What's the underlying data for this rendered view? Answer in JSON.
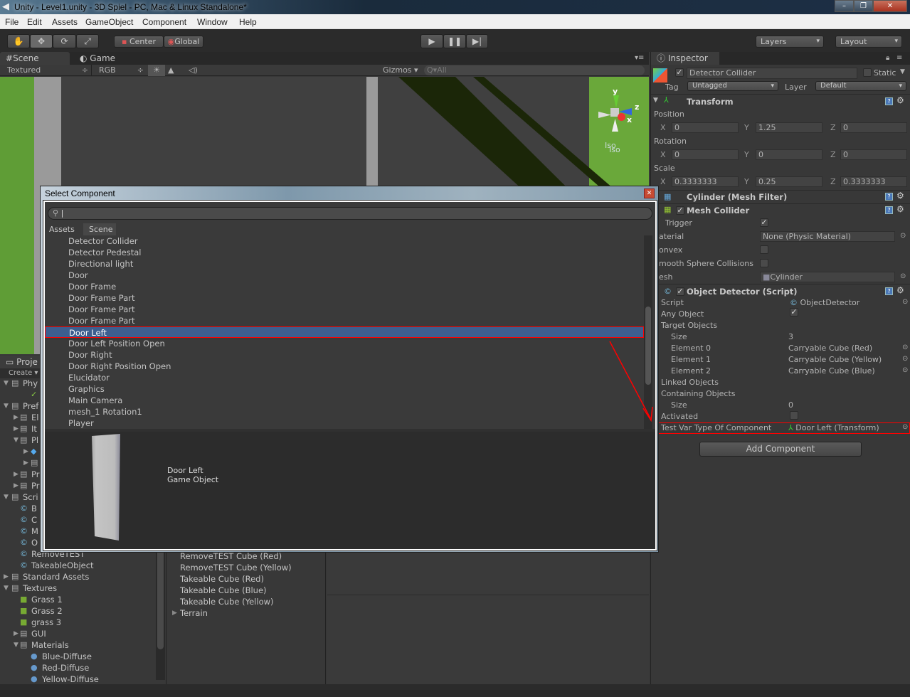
{
  "window": {
    "title": "Unity - Level1.unity - 3D Spiel - PC, Mac & Linux Standalone*",
    "controls": [
      "minimize",
      "maximize",
      "close"
    ]
  },
  "menu": [
    "File",
    "Edit",
    "Assets",
    "GameObject",
    "Component",
    "Window",
    "Help"
  ],
  "toolbar": {
    "tools": [
      "hand-icon",
      "move-icon",
      "rotate-icon",
      "scale-icon"
    ],
    "pivot": "Center",
    "space": "Global",
    "play": [
      "play-icon",
      "pause-icon",
      "step-icon"
    ],
    "layers": "Layers",
    "layout": "Layout"
  },
  "scene": {
    "tabs": [
      "Scene",
      "Game"
    ],
    "render_mode": "Textured",
    "channel": "RGB",
    "gizmos": "Gizmos",
    "search_placeholder": "All",
    "axis": {
      "x": "x",
      "y": "y",
      "z": "z"
    },
    "projection": "Iso"
  },
  "project": {
    "tab": "Proje",
    "create": "Create",
    "items": [
      {
        "label": "Phy",
        "level": 0,
        "icon": "folder",
        "open": true
      },
      {
        "label": "S",
        "level": 2,
        "icon": "physics-material"
      },
      {
        "label": "Pref",
        "level": 0,
        "icon": "folder",
        "open": true
      },
      {
        "label": "El",
        "level": 1,
        "icon": "folder",
        "open": false
      },
      {
        "label": "It",
        "level": 1,
        "icon": "folder",
        "open": false
      },
      {
        "label": "Pl",
        "level": 1,
        "icon": "folder",
        "open": true
      },
      {
        "label": "",
        "level": 2,
        "icon": "prefab",
        "open": false
      },
      {
        "label": "",
        "level": 2,
        "icon": "folder",
        "open": false
      },
      {
        "label": "Pr",
        "level": 1,
        "icon": "folder",
        "open": false
      },
      {
        "label": "Pr",
        "level": 1,
        "icon": "folder",
        "open": false
      },
      {
        "label": "Scri",
        "level": 0,
        "icon": "folder",
        "open": true
      },
      {
        "label": "B",
        "level": 1,
        "icon": "script"
      },
      {
        "label": "C",
        "level": 1,
        "icon": "script"
      },
      {
        "label": "M",
        "level": 1,
        "icon": "script"
      },
      {
        "label": "O",
        "level": 1,
        "icon": "script"
      },
      {
        "label": "RemoveTEST",
        "level": 1,
        "icon": "script"
      },
      {
        "label": "TakeableObject",
        "level": 1,
        "icon": "script"
      },
      {
        "label": "Standard Assets",
        "level": 0,
        "icon": "folder",
        "open": false
      },
      {
        "label": "Textures",
        "level": 0,
        "icon": "folder",
        "open": true
      },
      {
        "label": "Grass 1",
        "level": 1,
        "icon": "texture"
      },
      {
        "label": "Grass 2",
        "level": 1,
        "icon": "texture"
      },
      {
        "label": "grass 3",
        "level": 1,
        "icon": "texture"
      },
      {
        "label": "GUI",
        "level": 1,
        "icon": "folder",
        "open": false
      },
      {
        "label": "Materials",
        "level": 1,
        "icon": "folder",
        "open": true
      },
      {
        "label": "Blue-Diffuse",
        "level": 2,
        "icon": "material"
      },
      {
        "label": "Red-Diffuse",
        "level": 2,
        "icon": "material"
      },
      {
        "label": "Yellow-Diffuse",
        "level": 2,
        "icon": "material"
      }
    ]
  },
  "hierarchy": {
    "items": [
      "RemoveTEST Cube (Red)",
      "RemoveTEST Cube (Yellow)",
      "Takeable Cube  (Red)",
      "Takeable Cube (Blue)",
      "Takeable Cube (Yellow)",
      "Terrain"
    ]
  },
  "inspector": {
    "tab": "Inspector",
    "object": {
      "name": "Detector Collider",
      "active": true,
      "static_label": "Static",
      "static": false,
      "tag_label": "Tag",
      "tag": "Untagged",
      "layer_label": "Layer",
      "layer": "Default"
    },
    "transform": {
      "title": "Transform",
      "position_label": "Position",
      "rotation_label": "Rotation",
      "scale_label": "Scale",
      "position": {
        "x": "0",
        "y": "1.25",
        "z": "0"
      },
      "rotation": {
        "x": "0",
        "y": "0",
        "z": "0"
      },
      "scale": {
        "x": "0.3333333",
        "y": "0.25",
        "z": "0.3333333"
      }
    },
    "axis_labels": {
      "x": "X",
      "y": "Y",
      "z": "Z"
    },
    "mesh_filter": {
      "title": "Cylinder (Mesh Filter)"
    },
    "mesh_collider": {
      "title": "Mesh Collider",
      "enabled": true,
      "trigger_label": "Trigger",
      "trigger": true,
      "material_label": "aterial",
      "material": "None (Physic Material)",
      "convex_label": "onvex",
      "convex": false,
      "smooth_label": "mooth Sphere Collisions",
      "smooth": false,
      "mesh_label": "esh",
      "mesh": "Cylinder"
    },
    "object_detector": {
      "title": "Object Detector (Script)",
      "enabled": true,
      "script_label": "Script",
      "script": "ObjectDetector",
      "any_object_label": "Any Object",
      "any_object": true,
      "target_objects_label": "Target Objects",
      "size_label": "Size",
      "target_size": "3",
      "elements": [
        {
          "label": "Element 0",
          "value": "Carryable Cube (Red)"
        },
        {
          "label": "Element 1",
          "value": "Carryable Cube (Yellow)"
        },
        {
          "label": "Element 2",
          "value": "Carryable Cube (Blue)"
        }
      ],
      "linked_label": "Linked Objects",
      "containing_label": "Containing Objects",
      "containing_size": "0",
      "activated_label": "Activated",
      "activated": false,
      "test_var_label": "Test Var Type Of Component",
      "test_var": "Door Left (Transform)"
    },
    "add_component": "Add Component"
  },
  "dialog": {
    "title": "Select Component",
    "search_value": "",
    "tabs": [
      "Assets",
      "Scene"
    ],
    "active_tab": "Scene",
    "items": [
      "Detector Collider",
      "Detector Pedestal",
      "Directional light",
      "Door",
      "Door Frame",
      "Door Frame Part",
      "Door Frame Part",
      "Door Frame Part",
      "Door Left",
      "Door Left Position Open",
      "Door Right",
      "Door Right Position Open",
      "Elucidator",
      "Graphics",
      "Main Camera",
      "mesh_1 Rotation1",
      "Player"
    ],
    "selected": "Door Left",
    "preview": {
      "name": "Door Left",
      "type": "Game Object"
    }
  },
  "colors": {
    "selection": "#3d5e8f",
    "highlight": "#ff0000",
    "panel": "#383838"
  }
}
